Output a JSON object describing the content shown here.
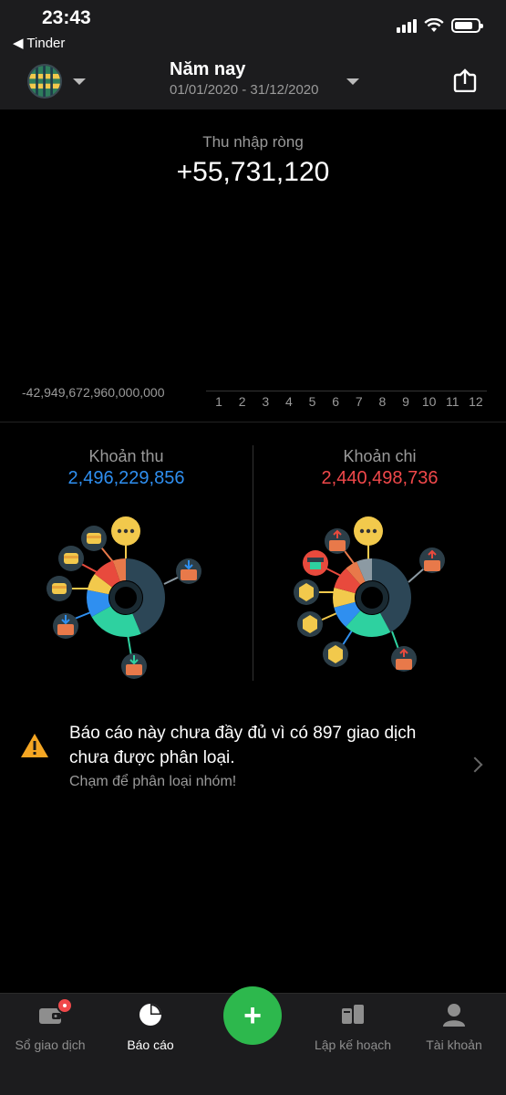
{
  "status_bar": {
    "time": "23:43",
    "back_app": "◀ Tinder"
  },
  "header": {
    "period_title": "Năm nay",
    "period_range": "01/01/2020 - 31/12/2020",
    "wallet_icon": "globe-icon",
    "share_icon": "share-icon"
  },
  "summary": {
    "net_label": "Thu nhập ròng",
    "net_value": "+55,731,120"
  },
  "chart_data": {
    "type": "bar",
    "categories": [
      "1",
      "2",
      "3",
      "4",
      "5",
      "6",
      "7",
      "8",
      "9",
      "10",
      "11",
      "12"
    ],
    "values": [],
    "ylabel": "",
    "y_min_label": "-42,949,672,960,000,000"
  },
  "income": {
    "title": "Khoản thu",
    "value": "2,496,229,856",
    "color": "#2f8ff0"
  },
  "expense": {
    "title": "Khoản chi",
    "value": "2,440,498,736",
    "color": "#f0484a"
  },
  "warning": {
    "text": "Báo cáo này chưa đầy đủ vì có 897 giao dịch chưa được phân loại.",
    "sub": "Chạm để phân loại nhóm!"
  },
  "tabs": [
    {
      "label": "Sổ giao dịch",
      "icon": "wallet-icon"
    },
    {
      "label": "Báo cáo",
      "icon": "pie-chart-icon"
    },
    {
      "label": "Lập kế hoạch",
      "icon": "planning-icon"
    },
    {
      "label": "Tài khoản",
      "icon": "user-icon"
    }
  ],
  "fab": {
    "label": "+"
  }
}
